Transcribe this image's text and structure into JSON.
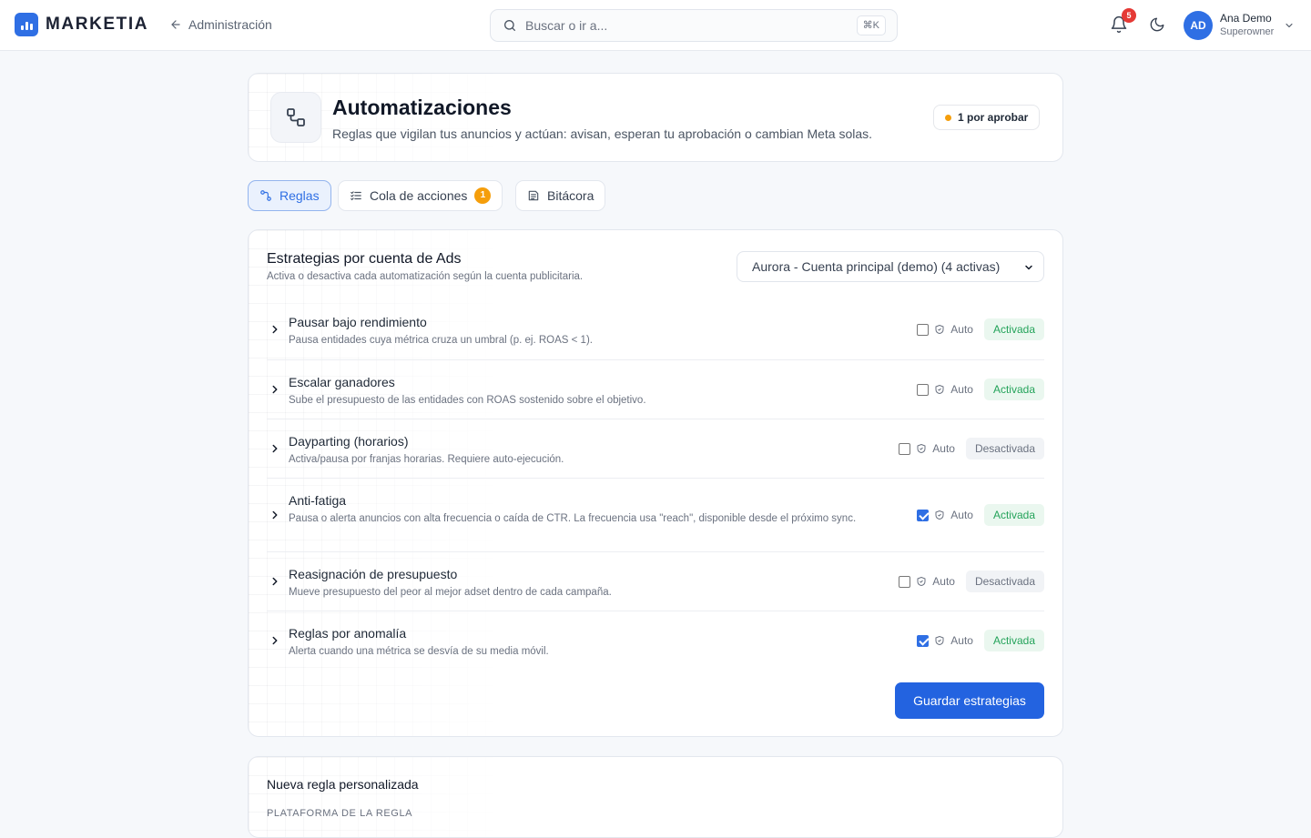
{
  "topbar": {
    "brand": "MARKETIA",
    "back_label": "Administración",
    "search_placeholder": "Buscar o ir a...",
    "search_shortcut": "⌘K",
    "notifications_count": "5",
    "user": {
      "initials": "AD",
      "name": "Ana Demo",
      "role": "Superowner"
    }
  },
  "header": {
    "title": "Automatizaciones",
    "subtitle": "Reglas que vigilan tus anuncios y actúan: avisan, esperan tu aprobación o cambian Meta solas.",
    "pending_label": "1 por aprobar",
    "pending_color": "#f59e0b"
  },
  "tabs": [
    {
      "label": "Reglas",
      "icon": "rules-icon",
      "active": true
    },
    {
      "label": "Cola de acciones",
      "icon": "queue-list-icon",
      "count": "1"
    },
    {
      "label": "Bitácora",
      "icon": "log-icon"
    }
  ],
  "strategies": {
    "title": "Estrategias por cuenta de Ads",
    "subtitle": "Activa o desactiva cada automatización según la cuenta publicitaria.",
    "account_selected": "Aurora - Cuenta principal (demo) (4 activas)",
    "auto_label": "Auto",
    "rules": [
      {
        "name": "Pausar bajo rendimiento",
        "description": "Pausa entidades cuya métrica cruza un umbral (p. ej. ROAS < 1).",
        "auto": false,
        "state": "Activada"
      },
      {
        "name": "Escalar ganadores",
        "description": "Sube el presupuesto de las entidades con ROAS sostenido sobre el objetivo.",
        "auto": false,
        "state": "Activada"
      },
      {
        "name": "Dayparting (horarios)",
        "description": "Activa/pausa por franjas horarias. Requiere auto-ejecución.",
        "auto": false,
        "state": "Desactivada"
      },
      {
        "name": "Anti-fatiga",
        "description": "Pausa o alerta anuncios con alta frecuencia o caída de CTR. La frecuencia usa \"reach\", disponible desde el próximo sync.",
        "auto": true,
        "state": "Activada"
      },
      {
        "name": "Reasignación de presupuesto",
        "description": "Mueve presupuesto del peor al mejor adset dentro de cada campaña.",
        "auto": false,
        "state": "Desactivada"
      },
      {
        "name": "Reglas por anomalía",
        "description": "Alerta cuando una métrica se desvía de su media móvil.",
        "auto": true,
        "state": "Activada"
      }
    ],
    "save_label": "Guardar estrategias",
    "colors": {
      "primary": "#2363e0",
      "active_text": "#24a35a",
      "active_bg": "#eaf7ef"
    }
  },
  "new_rule": {
    "title": "Nueva regla personalizada",
    "platform_label": "PLATAFORMA DE LA REGLA"
  }
}
